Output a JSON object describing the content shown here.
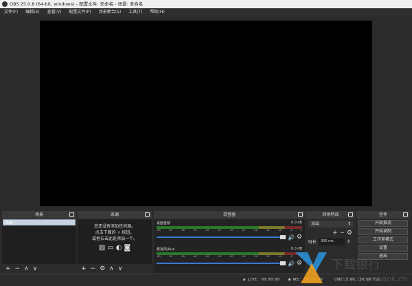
{
  "window": {
    "title": "OBS 25.0.8 (64-bit, windows) - 配置文件: 未命名 - 场景: 未命名"
  },
  "menu": [
    "文件(F)",
    "编辑(E)",
    "查看(V)",
    "配置文件(P)",
    "场景集合(S)",
    "工具(T)",
    "帮助(H)"
  ],
  "scenes": {
    "title": "场景",
    "items": [
      "场景"
    ]
  },
  "sources": {
    "title": "来源",
    "empty_lines": [
      "您还没有添加任何源。",
      "点击下面的 + 按钮，",
      "或者右击此处添加一个。"
    ]
  },
  "mixer": {
    "title": "混音器",
    "ticks": [
      "-60",
      "-55",
      "-50",
      "-45",
      "-40",
      "-35",
      "-30",
      "-25",
      "-20",
      "-15",
      "-10",
      "-5",
      "0"
    ],
    "channels": [
      {
        "name": "桌面音频",
        "level": "0.0 dB",
        "volume": 1.0
      },
      {
        "name": "麦克风/Aux",
        "level": "0.0 dB",
        "volume": 1.0
      }
    ]
  },
  "transitions": {
    "title": "转场特效",
    "selected": "淡出",
    "duration_label": "时长",
    "duration": "300 ms"
  },
  "controls": {
    "title": "控件",
    "buttons": [
      "开始推流",
      "开始录制",
      "工作室模式",
      "设置",
      "退出"
    ]
  },
  "status": {
    "live": "LIVE: 00:00:00",
    "rec": "REC: 00:00:00",
    "cpu": "CPU: 3.6%, 30.00 fps"
  },
  "watermark": {
    "text": "下载银行",
    "url": "www.downbank.cn"
  },
  "colors": {
    "meter_green": "#2a7a2a",
    "meter_yellow": "#7a7a2a",
    "meter_red": "#7a2a2a",
    "slider": "#3a7ad0"
  }
}
